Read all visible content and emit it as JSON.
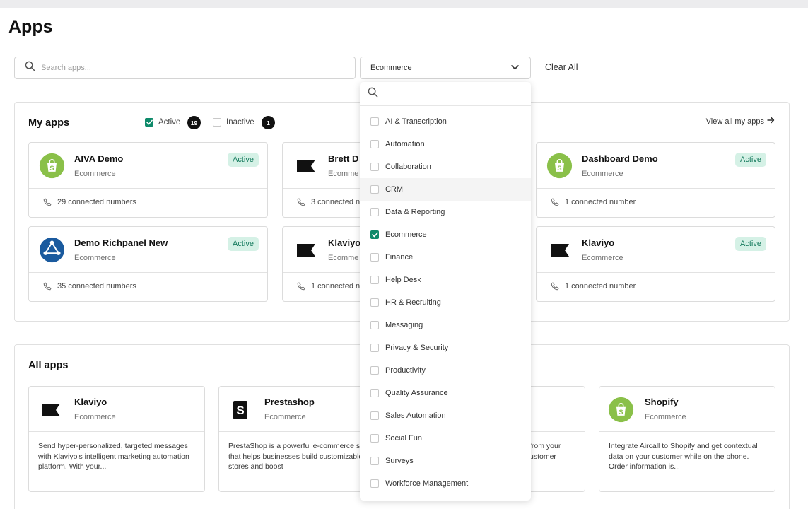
{
  "page": {
    "title": "Apps"
  },
  "filters": {
    "search_placeholder": "Search apps...",
    "category_selected": "Ecommerce",
    "clear_all": "Clear All"
  },
  "colors": {
    "accent": "#0e8a6a",
    "active_pill_bg": "#d5f1e6",
    "active_pill_text": "#157a5d",
    "shopify_green": "#8ac049",
    "richpanel_blue": "#1a5a9e"
  },
  "my_apps": {
    "heading": "My apps",
    "active_label": "Active",
    "active_count": "19",
    "inactive_label": "Inactive",
    "inactive_count": "1",
    "view_all": "View all my apps",
    "cards": [
      {
        "name": "AIVA Demo",
        "category": "Ecommerce",
        "status": "Active",
        "connected": "29 connected numbers",
        "icon": "shopify-icon"
      },
      {
        "name": "Brett D",
        "category": "Ecomme",
        "status": "",
        "connected": "3 connected n",
        "icon": "klaviyo-flag-icon"
      },
      {
        "name": "Dashboard Demo",
        "category": "Ecommerce",
        "status": "Active",
        "connected": "1 connected number",
        "icon": "shopify-icon"
      },
      {
        "name": "Demo Richpanel New",
        "category": "Ecommerce",
        "status": "Active",
        "connected": "35 connected numbers",
        "icon": "richpanel-icon"
      },
      {
        "name": "Klaviyo",
        "category": "Ecomme",
        "status": "",
        "connected": "1 connected n",
        "icon": "klaviyo-flag-icon"
      },
      {
        "name": "Klaviyo",
        "category": "Ecommerce",
        "status": "Active",
        "connected": "1 connected number",
        "icon": "klaviyo-flag-icon"
      }
    ]
  },
  "all_apps": {
    "heading": "All apps",
    "cards": [
      {
        "name": "Klaviyo",
        "category": "Ecommerce",
        "description": "Send hyper-personalized, targeted messages with Klaviyo's intelligent marketing automation platform. With your...",
        "icon": "klaviyo-flag-icon"
      },
      {
        "name": "Prestashop",
        "category": "Ecommerce",
        "description": "PrestaShop is a powerful e-commerce solution that helps businesses build customizable online stores and boost",
        "icon": "prestashop-icon"
      },
      {
        "name": "",
        "category": "",
        "description": "from your ustomer",
        "icon": ""
      },
      {
        "name": "Shopify",
        "category": "Ecommerce",
        "description": "Integrate Aircall to Shopify and get contextual data on your customer while on the phone. Order information is...",
        "icon": "shopify-icon"
      }
    ]
  },
  "category_dropdown": {
    "items": [
      {
        "label": "AI & Transcription",
        "checked": false
      },
      {
        "label": "Automation",
        "checked": false
      },
      {
        "label": "Collaboration",
        "checked": false
      },
      {
        "label": "CRM",
        "checked": false
      },
      {
        "label": "Data & Reporting",
        "checked": false
      },
      {
        "label": "Ecommerce",
        "checked": true
      },
      {
        "label": "Finance",
        "checked": false
      },
      {
        "label": "Help Desk",
        "checked": false
      },
      {
        "label": "HR & Recruiting",
        "checked": false
      },
      {
        "label": "Messaging",
        "checked": false
      },
      {
        "label": "Privacy & Security",
        "checked": false
      },
      {
        "label": "Productivity",
        "checked": false
      },
      {
        "label": "Quality Assurance",
        "checked": false
      },
      {
        "label": "Sales Automation",
        "checked": false
      },
      {
        "label": "Social Fun",
        "checked": false
      },
      {
        "label": "Surveys",
        "checked": false
      },
      {
        "label": "Workforce Management",
        "checked": false
      }
    ]
  }
}
